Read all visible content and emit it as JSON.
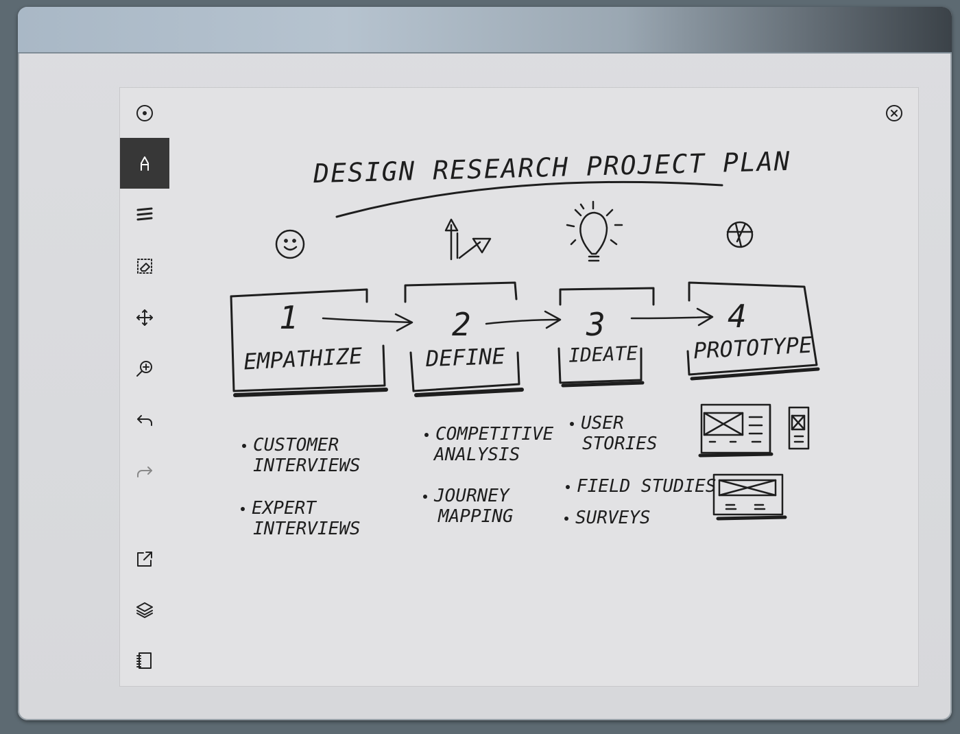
{
  "toolbar": {
    "items": [
      {
        "icon": "menu-circle-icon"
      },
      {
        "icon": "pen-tool-icon"
      },
      {
        "icon": "marker-lines-icon"
      },
      {
        "icon": "eraser-select-icon"
      },
      {
        "icon": "move-icon"
      },
      {
        "icon": "zoom-icon"
      },
      {
        "icon": "undo-icon"
      },
      {
        "icon": "redo-icon"
      },
      {
        "icon": "export-icon"
      },
      {
        "icon": "layers-icon"
      },
      {
        "icon": "notebook-icon"
      }
    ],
    "active_index": 1
  },
  "close_icon": "close-circle-icon",
  "note": {
    "title": "DESIGN RESEARCH PROJECT PLAN",
    "steps": [
      {
        "number": "1",
        "label": "EMPATHIZE",
        "bullets": [
          "CUSTOMER INTERVIEWS",
          "EXPERT INTERVIEWS"
        ]
      },
      {
        "number": "2",
        "label": "DEFINE",
        "bullets": [
          "COMPETITIVE ANALYSIS",
          "JOURNEY MAPPING"
        ]
      },
      {
        "number": "3",
        "label": "IDEATE",
        "bullets": [
          "USER STORIES",
          "FIELD STUDIES",
          "SURVEYS"
        ]
      },
      {
        "number": "4",
        "label": "PROTOTYPE",
        "bullets": []
      }
    ],
    "b": {
      "s1a1": "CUSTOMER",
      "s1a2": "INTERVIEWS",
      "s1b1": "EXPERT",
      "s1b2": "INTERVIEWS",
      "s2a1": "COMPETITIVE",
      "s2a2": "ANALYSIS",
      "s2b1": "JOURNEY",
      "s2b2": "MAPPING",
      "s3a1": "USER",
      "s3a2": "STORIES",
      "s3b1": "FIELD STUDIES",
      "s3c1": "SURVEYS"
    }
  },
  "colors": {
    "ink": "#1e1e1e",
    "paper": "#e2e2e4",
    "active_tool": "#373737"
  }
}
